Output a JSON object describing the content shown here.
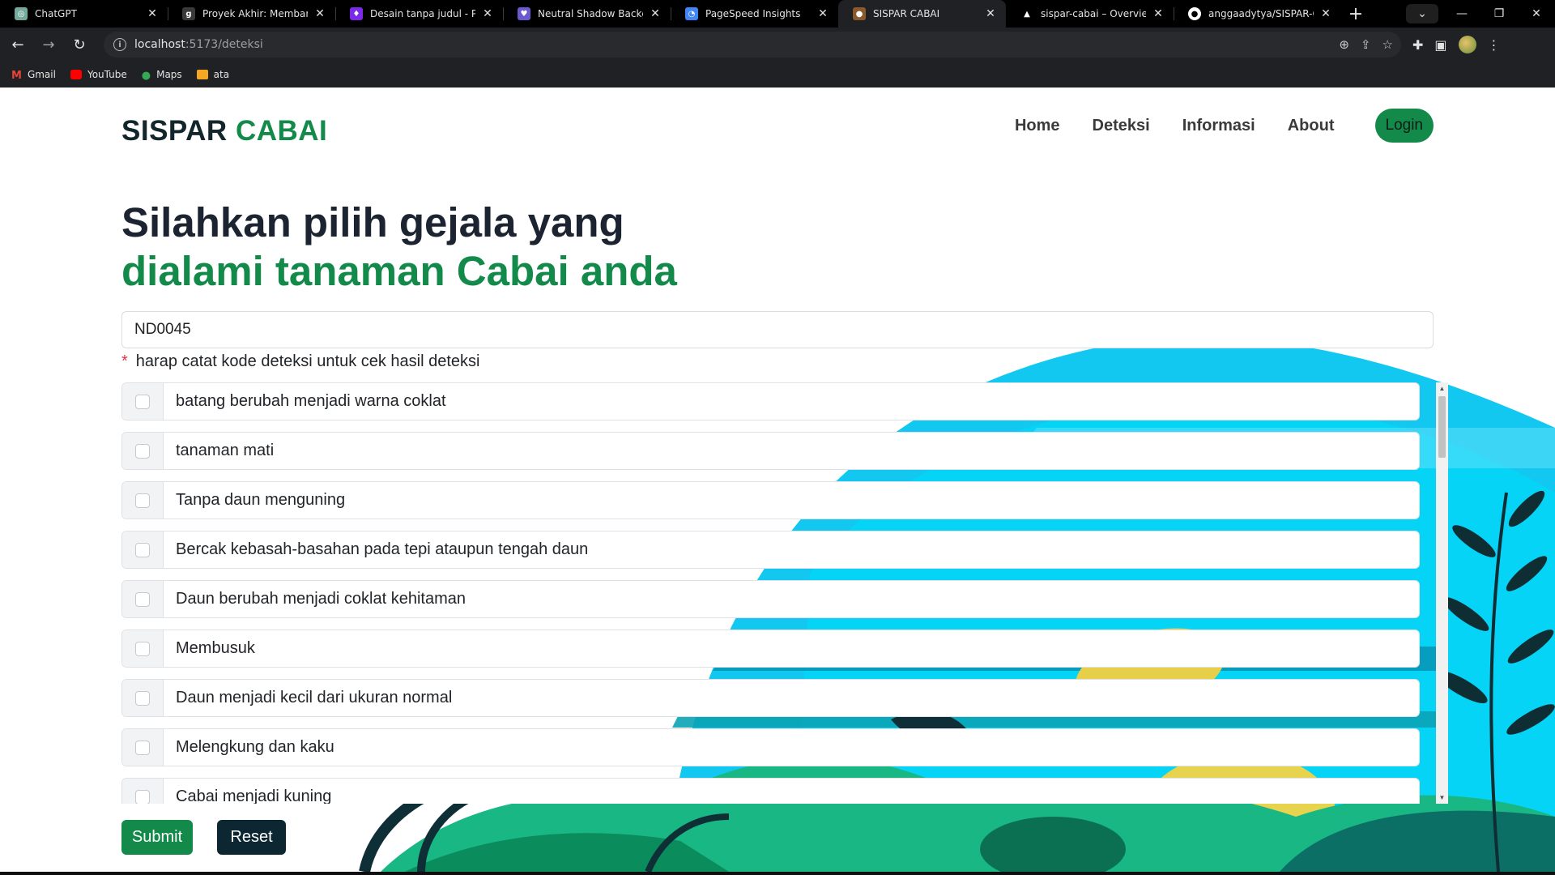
{
  "browser": {
    "tabs": [
      {
        "title": "ChatGPT",
        "icon": "chatgpt-icon",
        "color": "#74aa9c"
      },
      {
        "title": "Proyek Akhir: Membangu",
        "icon": "g-icon",
        "color": "#3a3a3a"
      },
      {
        "title": "Desain tanpa judul - Pres",
        "icon": "canva-icon",
        "color": "#7d2ae8"
      },
      {
        "title": "Neutral Shadow Backgrou",
        "icon": "heart-icon",
        "color": "#6a5acd"
      },
      {
        "title": "PageSpeed Insights",
        "icon": "pagespeed-icon",
        "color": "#4285f4"
      },
      {
        "title": "SISPAR CABAI",
        "icon": "sispar-icon",
        "color": "#8b5a2b",
        "active": true
      },
      {
        "title": "sispar-cabai – Overview –",
        "icon": "vercel-icon",
        "color": "#ffffff"
      },
      {
        "title": "anggaadytya/SISPAR-CAB",
        "icon": "github-icon",
        "color": "#ffffff"
      }
    ],
    "url_host": "localhost",
    "url_path": ":5173/deteksi",
    "bookmarks": [
      {
        "label": "Gmail",
        "color": "#ea4335"
      },
      {
        "label": "YouTube",
        "color": "#ff0000"
      },
      {
        "label": "Maps",
        "color": "#34a853"
      },
      {
        "label": "ata",
        "color": "#f5a623"
      }
    ]
  },
  "brand": {
    "part1": "SISPAR",
    "part2": "CABAI"
  },
  "nav": {
    "home": "Home",
    "deteksi": "Deteksi",
    "informasi": "Informasi",
    "about": "About",
    "login": "Login"
  },
  "heading": {
    "line1": "Silahkan pilih gejala yang",
    "line2": "dialami tanaman Cabai anda"
  },
  "form": {
    "code_value": "ND0045",
    "note_star": "*",
    "note": "harap catat kode deteksi untuk cek hasil deteksi",
    "symptoms": [
      "batang berubah menjadi warna coklat",
      "tanaman mati",
      "Tanpa daun menguning",
      "Bercak kebasah-basahan pada tepi ataupun tengah daun",
      "Daun berubah menjadi coklat kehitaman",
      "Membusuk",
      "Daun menjadi kecil dari ukuran normal",
      "Melengkung dan kaku",
      "Cabai menjadi kuning"
    ],
    "submit": "Submit",
    "reset": "Reset"
  },
  "colors": {
    "brand_dark": "#12262b",
    "brand_green": "#138a4a",
    "reset_dark": "#0c2731"
  }
}
